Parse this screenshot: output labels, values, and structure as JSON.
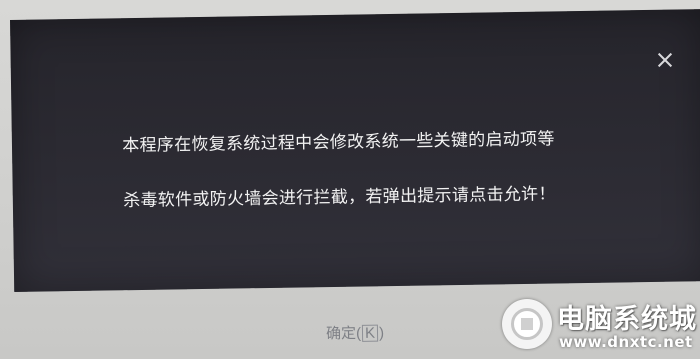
{
  "dialog": {
    "close_icon": "close-icon",
    "message_line1": "本程序在恢复系统过程中会修改系统一些关键的启动项等",
    "message_line2": "杀毒软件或防火墙会进行拦截，若弹出提示请点击允许！",
    "ok_button": {
      "label": "确定(",
      "hotkey": "K",
      "suffix": ")"
    }
  },
  "watermark": {
    "logo_icon": "site-logo-icon",
    "title": "电脑系统城",
    "url": "www.dnxtc.net"
  },
  "colors": {
    "dialog_background": "#2a2930",
    "message_text": "#f2f2f2",
    "button_text": "#7e8086",
    "page_background": "#d0d0ce"
  }
}
